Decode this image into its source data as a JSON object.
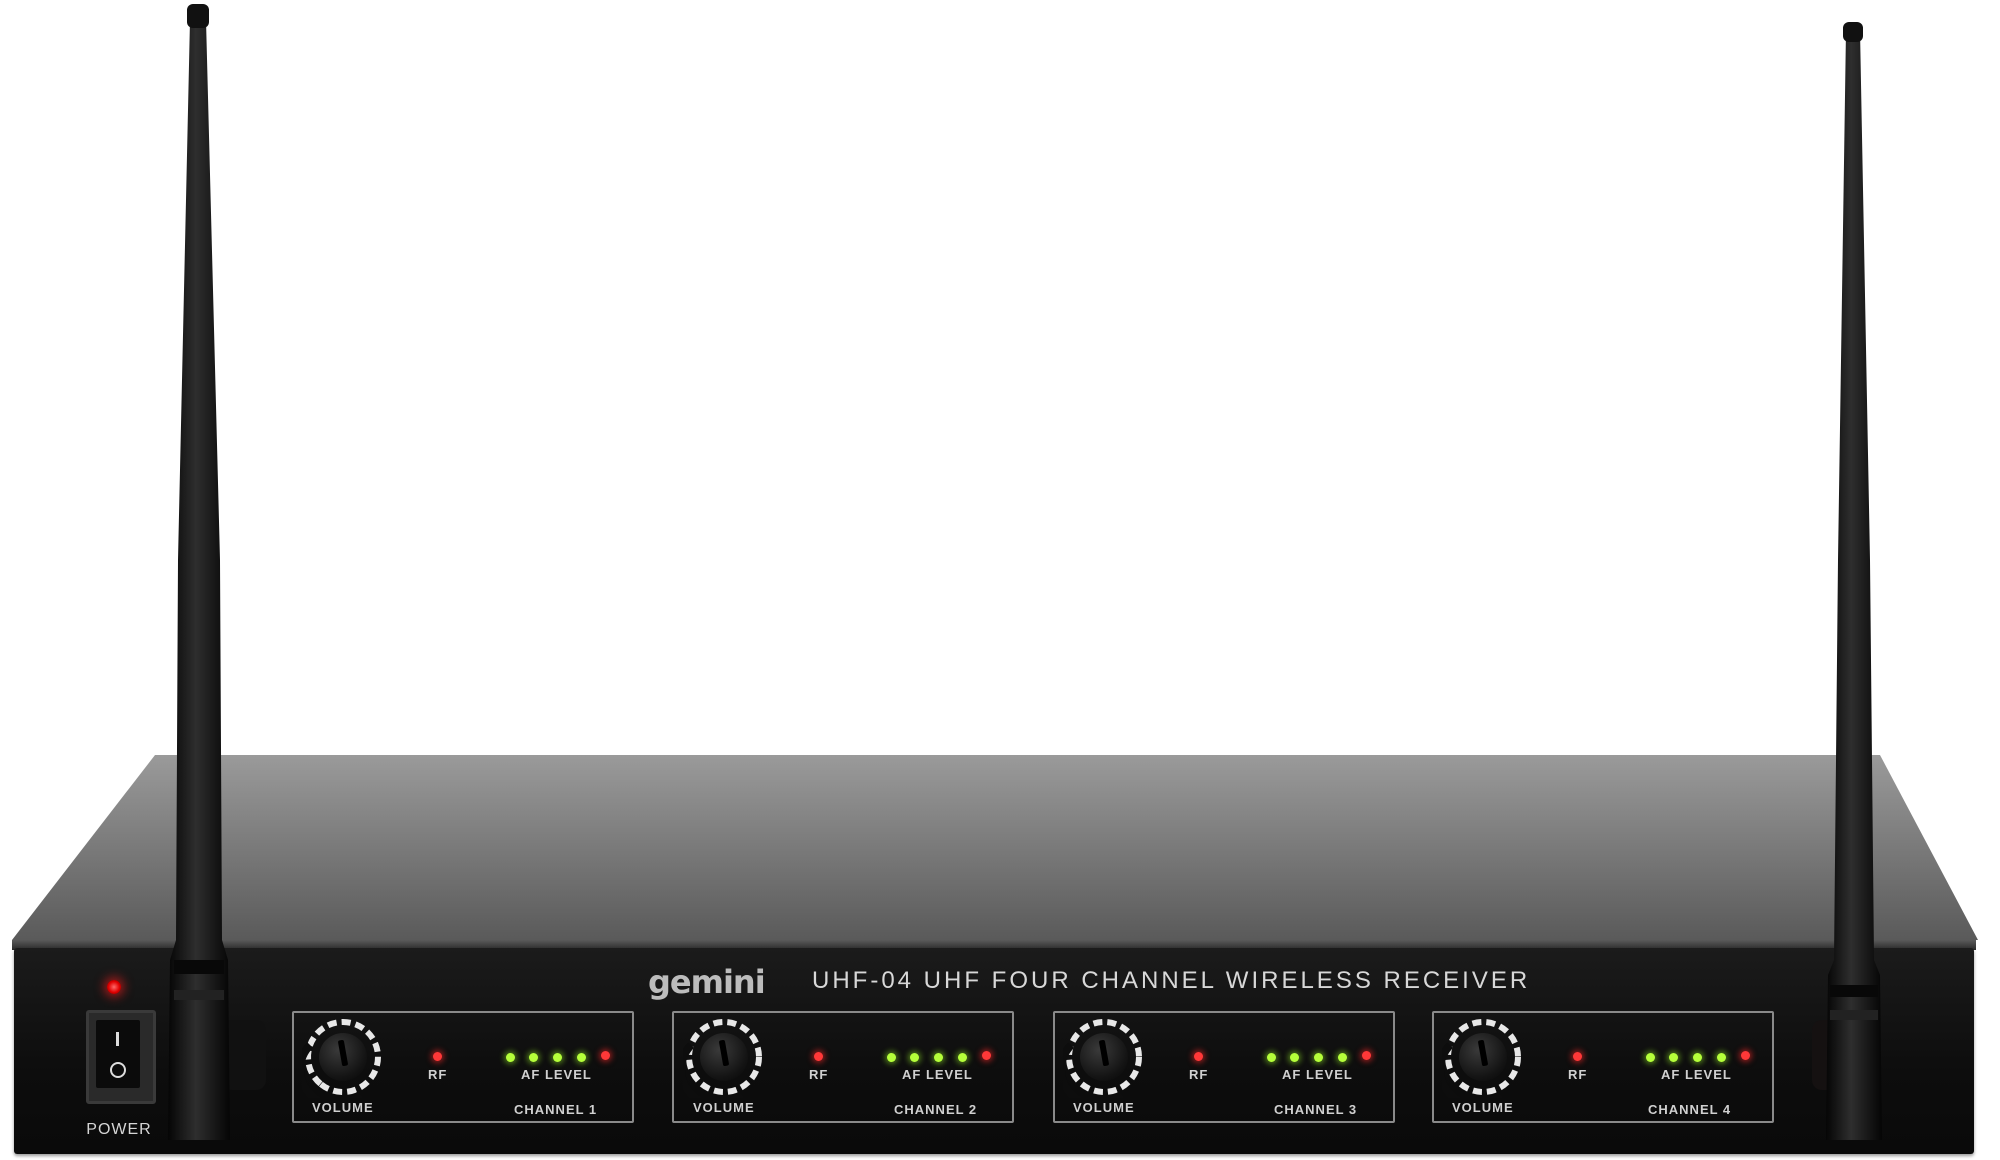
{
  "power": {
    "label": "POWER",
    "led_color": "#e00000"
  },
  "branding": {
    "brand": "gemini",
    "title": "UHF-04 UHF FOUR CHANNEL WIRELESS RECEIVER"
  },
  "channels": [
    {
      "volume_label": "VOLUME",
      "rf_label": "RF",
      "af_label": "AF LEVEL",
      "channel_label": "CHANNEL 1"
    },
    {
      "volume_label": "VOLUME",
      "rf_label": "RF",
      "af_label": "AF LEVEL",
      "channel_label": "CHANNEL 2"
    },
    {
      "volume_label": "VOLUME",
      "rf_label": "RF",
      "af_label": "AF LEVEL",
      "channel_label": "CHANNEL 3"
    },
    {
      "volume_label": "VOLUME",
      "rf_label": "RF",
      "af_label": "AF LEVEL",
      "channel_label": "CHANNEL 4"
    }
  ],
  "indicator_colors": {
    "rf": "#ff3838",
    "af_green": "#b5ff3a",
    "af_peak": "#ff3838"
  }
}
